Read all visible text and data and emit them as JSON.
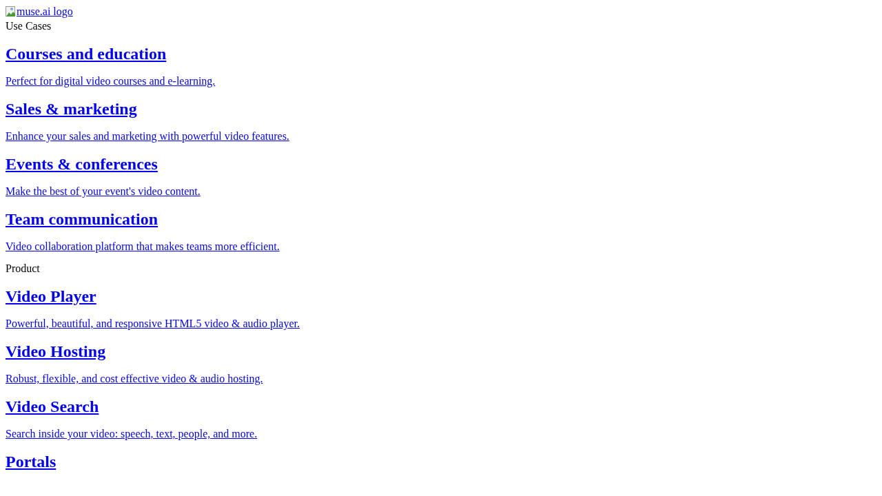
{
  "logo_link": {
    "text": "muse.ai logo"
  },
  "sections": [
    {
      "label": "Use Cases",
      "items": [
        {
          "title": "Courses and education",
          "description": "Perfect for digital video courses and e-learning."
        },
        {
          "title": "Sales & marketing",
          "description": "Enhance your sales and marketing with powerful video features."
        },
        {
          "title": "Events & conferences",
          "description": "Make the best of your event's video content."
        },
        {
          "title": "Team communication",
          "description": "Video collaboration platform that makes teams more efficient."
        }
      ]
    },
    {
      "label": "Product",
      "items": [
        {
          "title": "Video Player",
          "description": "Powerful, beautiful, and responsive HTML5 video & audio player."
        },
        {
          "title": "Video Hosting",
          "description": "Robust, flexible, and cost effective video & audio hosting."
        },
        {
          "title": "Video Search",
          "description": "Search inside your video: speech, text, people, and more."
        },
        {
          "title": "Portals"
        }
      ]
    }
  ]
}
